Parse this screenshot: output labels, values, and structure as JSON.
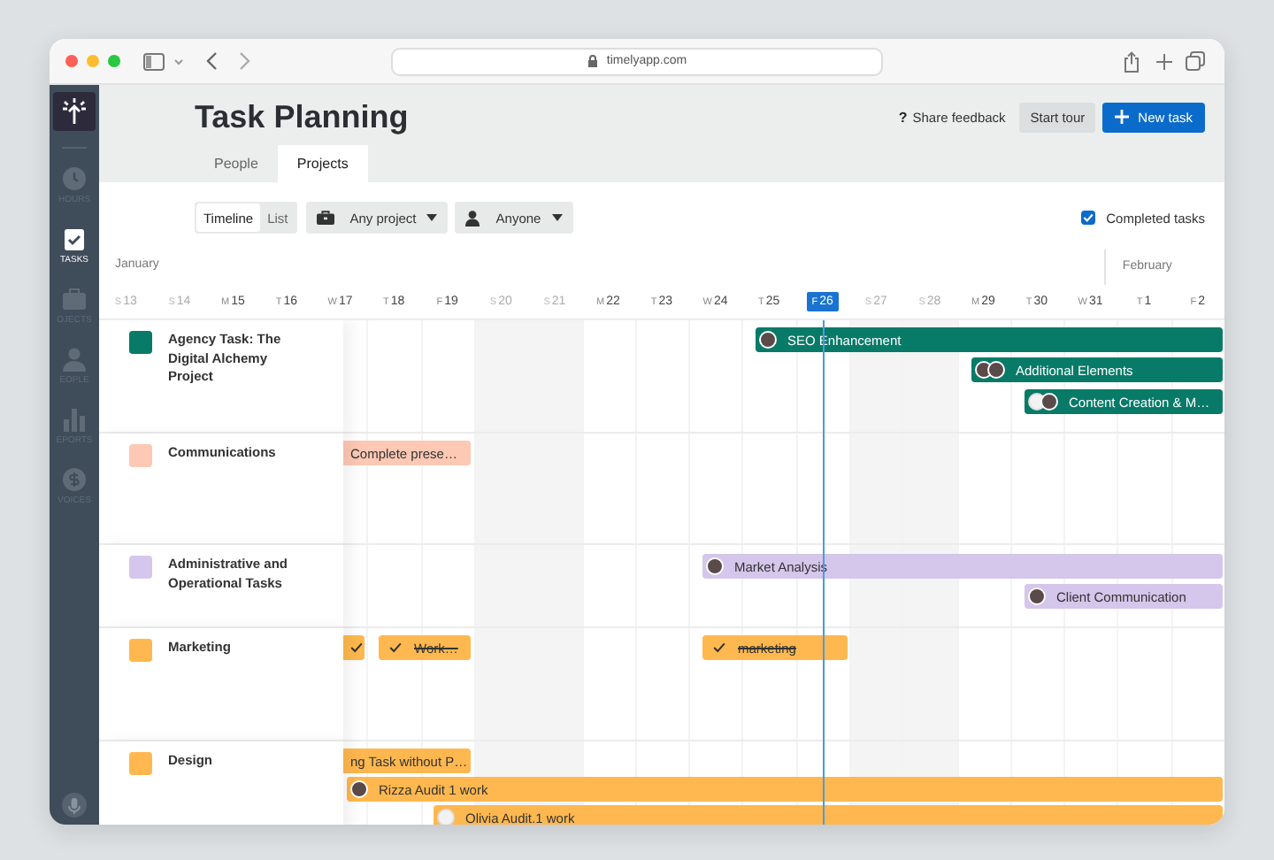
{
  "browser": {
    "url": "timelyapp.com"
  },
  "sidebar": {
    "items": [
      {
        "kind": "clock",
        "label": "HOURS",
        "selected": false
      },
      {
        "kind": "tasks",
        "label": "TASKS",
        "selected": true
      },
      {
        "kind": "briefcase",
        "label": "OJECTS",
        "selected": false
      },
      {
        "kind": "person",
        "label": "EOPLE",
        "selected": false
      },
      {
        "kind": "chart",
        "label": "EPORTS",
        "selected": false
      },
      {
        "kind": "dollar",
        "label": "VOICES",
        "selected": false
      }
    ]
  },
  "header": {
    "title": "Task Planning",
    "help_glyph": "?",
    "feedback": "Share feedback",
    "tour_button": "Start tour",
    "new_button": "New task"
  },
  "tabs": [
    {
      "label": "People",
      "selected": false
    },
    {
      "label": "Projects",
      "selected": true
    }
  ],
  "view_toggle": [
    {
      "label": "Timeline",
      "selected": true
    },
    {
      "label": "List",
      "selected": false
    }
  ],
  "filters": [
    {
      "kind": "project",
      "label": "Any project"
    },
    {
      "kind": "person",
      "label": "Anyone"
    }
  ],
  "completed_tasks": {
    "label": "Completed tasks",
    "checked": true
  },
  "months": [
    "January",
    "February"
  ],
  "days": [
    {
      "weekday": "S",
      "date": "13",
      "weekend": true,
      "today": false
    },
    {
      "weekday": "S",
      "date": "14",
      "weekend": true,
      "today": false
    },
    {
      "weekday": "M",
      "date": "15",
      "weekend": false,
      "today": false
    },
    {
      "weekday": "T",
      "date": "16",
      "weekend": false,
      "today": false
    },
    {
      "weekday": "W",
      "date": "17",
      "weekend": false,
      "today": false
    },
    {
      "weekday": "T",
      "date": "18",
      "weekend": false,
      "today": false
    },
    {
      "weekday": "F",
      "date": "19",
      "weekend": false,
      "today": false
    },
    {
      "weekday": "S",
      "date": "20",
      "weekend": true,
      "today": false
    },
    {
      "weekday": "S",
      "date": "21",
      "weekend": true,
      "today": false
    },
    {
      "weekday": "M",
      "date": "22",
      "weekend": false,
      "today": false
    },
    {
      "weekday": "T",
      "date": "23",
      "weekend": false,
      "today": false
    },
    {
      "weekday": "W",
      "date": "24",
      "weekend": false,
      "today": false
    },
    {
      "weekday": "T",
      "date": "25",
      "weekend": false,
      "today": false
    },
    {
      "weekday": "F",
      "date": "26",
      "weekend": false,
      "today": true
    },
    {
      "weekday": "S",
      "date": "27",
      "weekend": true,
      "today": false
    },
    {
      "weekday": "S",
      "date": "28",
      "weekend": true,
      "today": false
    },
    {
      "weekday": "M",
      "date": "29",
      "weekend": false,
      "today": false
    },
    {
      "weekday": "T",
      "date": "30",
      "weekend": false,
      "today": false
    },
    {
      "weekday": "W",
      "date": "31",
      "weekend": false,
      "today": false
    },
    {
      "weekday": "T",
      "date": "1",
      "weekend": false,
      "today": false
    },
    {
      "weekday": "F",
      "date": "2",
      "weekend": false,
      "today": false
    }
  ],
  "projects": [
    {
      "name": "Agency Task: The Digital Alchemy Project",
      "color": "#087a68",
      "tasks": [
        {
          "title": "SEO Enhancement",
          "completed": false,
          "avatars": [
            {
              "kind": "photo"
            }
          ]
        },
        {
          "title": "Additional Elements",
          "completed": false,
          "avatars": [
            {
              "kind": "photo"
            },
            {
              "kind": "photo"
            }
          ]
        },
        {
          "title": "Content Creation & M…",
          "completed": false,
          "avatars": [
            {
              "kind": "blank"
            },
            {
              "kind": "photo"
            }
          ]
        }
      ]
    },
    {
      "name": "Communications",
      "color": "#fdc8b4",
      "tasks": [
        {
          "title": "Complete prese…",
          "completed": false
        }
      ]
    },
    {
      "name": "Administrative and Operational Tasks",
      "color": "#d5c6eb",
      "tasks": [
        {
          "title": "Market Analysis",
          "completed": false,
          "avatars": [
            {
              "kind": "photo"
            }
          ]
        },
        {
          "title": "Client Communication",
          "completed": false,
          "avatars": [
            {
              "kind": "photo"
            }
          ]
        }
      ]
    },
    {
      "name": "Marketing",
      "color": "#ffb84f",
      "tasks": [
        {
          "completed": true
        },
        {
          "title": "Work…",
          "completed": true
        },
        {
          "title": "marketing",
          "completed": true
        }
      ]
    },
    {
      "name": "Design",
      "color": "#ffb84f",
      "tasks": [
        {
          "title": "ng Task without P…",
          "completed": false
        },
        {
          "title": "Rizza Audit 1 work",
          "completed": false,
          "avatars": [
            {
              "kind": "photo"
            }
          ]
        },
        {
          "title": "Olivia Audit.1 work",
          "completed": false,
          "avatars": [
            {
              "kind": "blank"
            }
          ]
        }
      ]
    }
  ]
}
